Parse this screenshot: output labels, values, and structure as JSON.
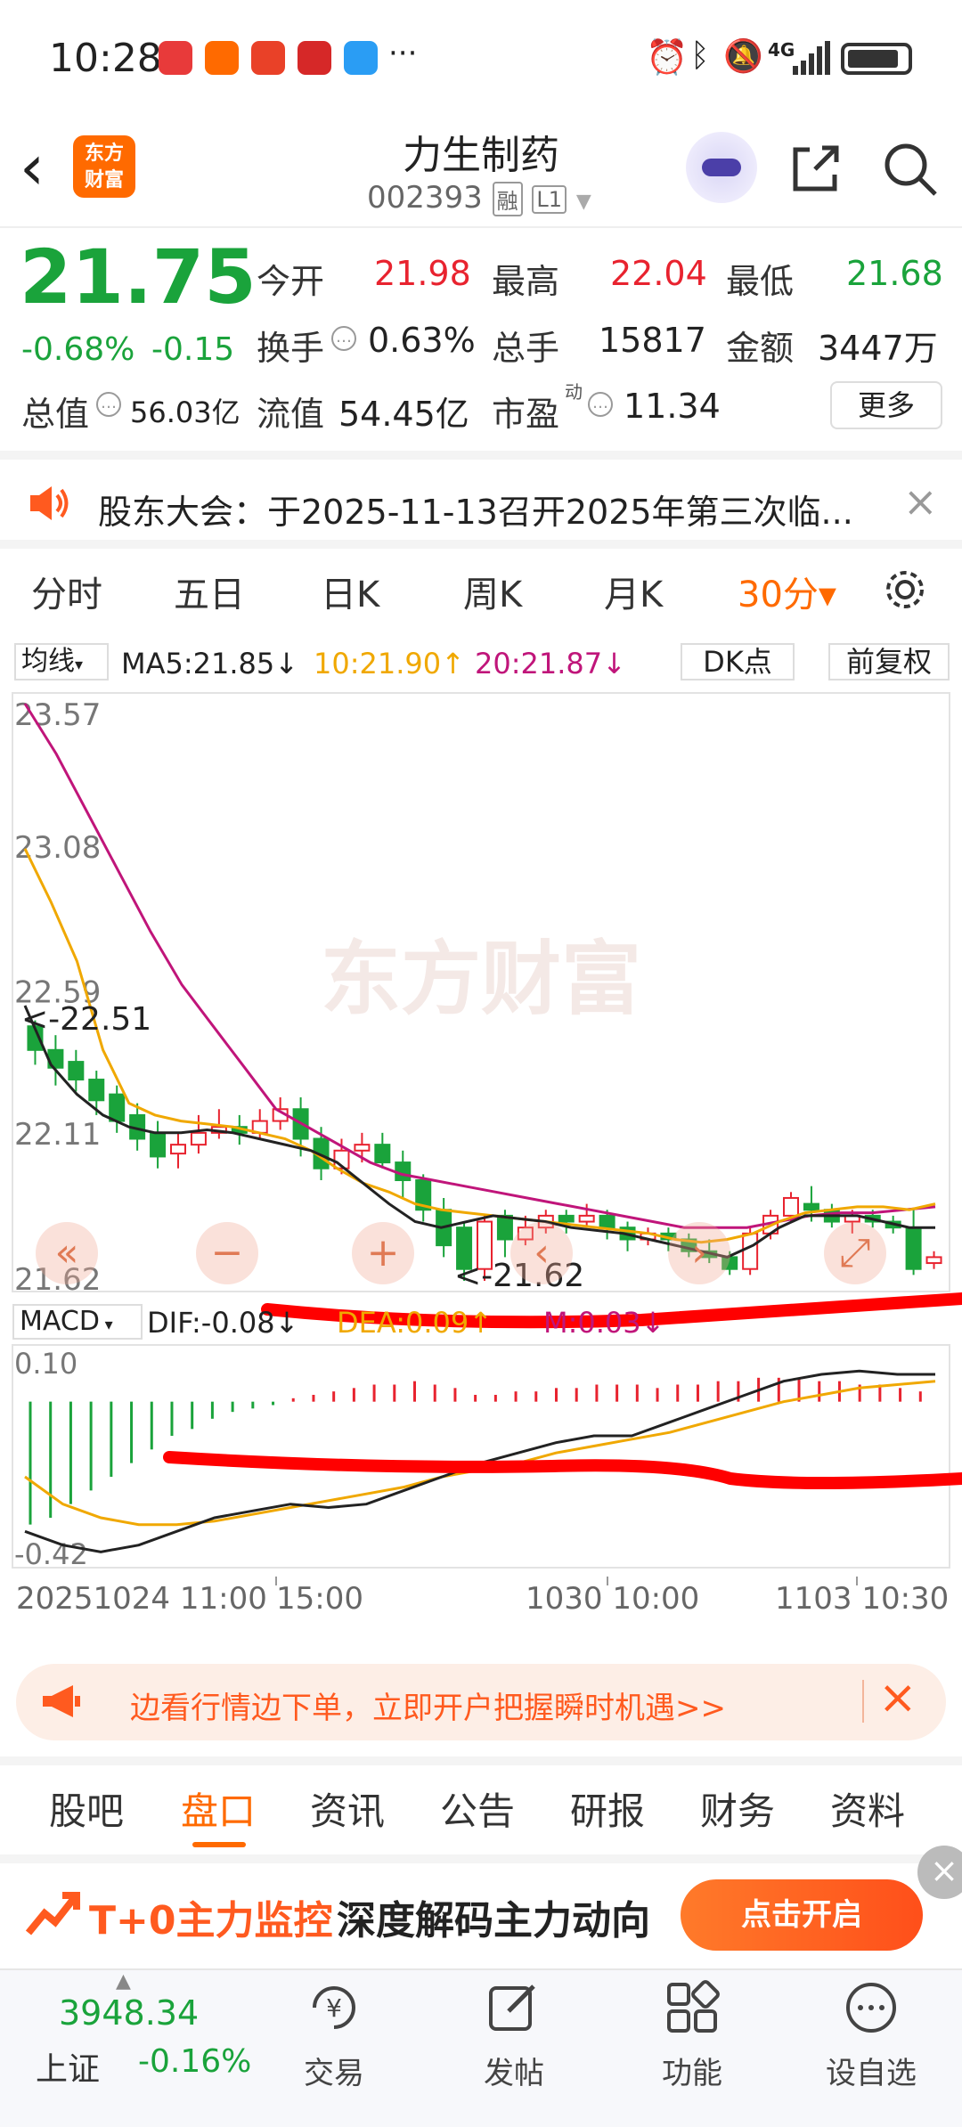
{
  "status_bar": {
    "time": "10:28",
    "dots": "···",
    "net": "4G"
  },
  "header": {
    "back_icon": "chevron-left",
    "logo_line1": "东方",
    "logo_line2": "财富",
    "title": "力生制药",
    "code": "002393",
    "tag_rong": "融",
    "tag_l1": "L1"
  },
  "quote": {
    "price": "21.75",
    "change_pct": "-0.68%",
    "change": "-0.15",
    "open_label": "今开",
    "open": "21.98",
    "high_label": "最高",
    "high": "22.04",
    "low_label": "最低",
    "low": "21.68",
    "turnover_label": "换手",
    "turnover": "0.63%",
    "volume_label": "总手",
    "volume": "15817",
    "amount_label": "金额",
    "amount": "3447万",
    "mktcap_label": "总值",
    "mktcap": "56.03亿",
    "float_label": "流值",
    "float": "54.45亿",
    "pe_label": "市盈",
    "pe_sup": "动",
    "pe": "11.34",
    "more": "更多"
  },
  "notice": {
    "text": "股东大会：于2025-11-13召开2025年第三次临..."
  },
  "ktabs": [
    "分时",
    "五日",
    "日K",
    "周K",
    "月K",
    "30分▾"
  ],
  "ma_bar": {
    "type": "均线",
    "ma5": "MA5:21.85↓",
    "ma10": "10:21.90↑",
    "ma20": "20:21.87↓",
    "dk": "DK点",
    "fq": "前复权"
  },
  "chart_data": {
    "type": "candlestick",
    "yticks": [
      "23.57",
      "23.08",
      "22.59",
      "22.11",
      "21.62"
    ],
    "high_marker": "<-22.51",
    "low_marker": "<-21.62",
    "xticks": [
      "20251024 11:00",
      "15:00",
      "1030 10:00",
      "1103 10:30"
    ],
    "watermark": "东方财富",
    "candles": [
      [
        22.48,
        22.4,
        22.5,
        22.35
      ],
      [
        22.4,
        22.34,
        22.45,
        22.28
      ],
      [
        22.36,
        22.3,
        22.4,
        22.26
      ],
      [
        22.3,
        22.23,
        22.33,
        22.18
      ],
      [
        22.25,
        22.16,
        22.28,
        22.12
      ],
      [
        22.18,
        22.1,
        22.22,
        22.06
      ],
      [
        22.12,
        22.04,
        22.16,
        22.0
      ],
      [
        22.05,
        22.08,
        22.12,
        22.0
      ],
      [
        22.08,
        22.12,
        22.18,
        22.05
      ],
      [
        22.12,
        22.14,
        22.2,
        22.1
      ],
      [
        22.14,
        22.12,
        22.18,
        22.08
      ],
      [
        22.12,
        22.16,
        22.2,
        22.1
      ],
      [
        22.16,
        22.2,
        22.24,
        22.13
      ],
      [
        22.2,
        22.1,
        22.24,
        22.04
      ],
      [
        22.1,
        22.0,
        22.14,
        21.96
      ],
      [
        22.0,
        22.06,
        22.1,
        21.98
      ],
      [
        22.06,
        22.08,
        22.12,
        22.02
      ],
      [
        22.08,
        22.02,
        22.12,
        22.0
      ],
      [
        22.02,
        21.96,
        22.06,
        21.9
      ],
      [
        21.96,
        21.86,
        21.98,
        21.82
      ],
      [
        21.86,
        21.74,
        21.9,
        21.7
      ],
      [
        21.8,
        21.66,
        21.82,
        21.62
      ],
      [
        21.66,
        21.82,
        21.84,
        21.62
      ],
      [
        21.84,
        21.76,
        21.86,
        21.7
      ],
      [
        21.76,
        21.8,
        21.84,
        21.74
      ],
      [
        21.8,
        21.84,
        21.86,
        21.78
      ],
      [
        21.84,
        21.82,
        21.86,
        21.78
      ],
      [
        21.82,
        21.84,
        21.88,
        21.8
      ],
      [
        21.84,
        21.8,
        21.86,
        21.76
      ],
      [
        21.8,
        21.76,
        21.82,
        21.72
      ],
      [
        21.76,
        21.78,
        21.8,
        21.74
      ],
      [
        21.78,
        21.76,
        21.8,
        21.72
      ],
      [
        21.76,
        21.72,
        21.78,
        21.7
      ],
      [
        21.72,
        21.7,
        21.76,
        21.68
      ],
      [
        21.7,
        21.66,
        21.72,
        21.64
      ],
      [
        21.66,
        21.78,
        21.8,
        21.64
      ],
      [
        21.78,
        21.84,
        21.86,
        21.76
      ],
      [
        21.84,
        21.9,
        21.92,
        21.82
      ],
      [
        21.88,
        21.86,
        21.94,
        21.82
      ],
      [
        21.86,
        21.82,
        21.88,
        21.8
      ],
      [
        21.82,
        21.84,
        21.86,
        21.78
      ],
      [
        21.84,
        21.82,
        21.86,
        21.8
      ],
      [
        21.82,
        21.8,
        21.84,
        21.78
      ],
      [
        21.8,
        21.66,
        21.86,
        21.64
      ],
      [
        21.68,
        21.7,
        21.72,
        21.66
      ]
    ],
    "ma5": [
      22.55,
      22.35,
      22.25,
      22.18,
      22.14,
      22.12,
      22.12,
      22.13,
      22.12,
      22.1,
      22.08,
      22.06,
      22.02,
      21.95,
      21.88,
      21.82,
      21.8,
      21.82,
      21.84,
      21.83,
      21.82,
      21.8,
      21.79,
      21.78,
      21.76,
      21.74,
      21.72,
      21.7,
      21.74,
      21.8,
      21.84,
      21.84,
      21.84,
      21.82,
      21.8,
      21.8
    ],
    "ma10": [
      23.08,
      22.9,
      22.7,
      22.4,
      22.22,
      22.18,
      22.16,
      22.15,
      22.14,
      22.12,
      22.1,
      22.06,
      22.0,
      21.95,
      21.92,
      21.88,
      21.86,
      21.85,
      21.84,
      21.83,
      21.82,
      21.81,
      21.8,
      21.79,
      21.78,
      21.76,
      21.75,
      21.76,
      21.78,
      21.82,
      21.85,
      21.86,
      21.87,
      21.87,
      21.86,
      21.88
    ],
    "ma20": [
      23.57,
      23.4,
      23.2,
      23.0,
      22.8,
      22.62,
      22.48,
      22.34,
      22.2,
      22.14,
      22.08,
      22.02,
      21.98,
      21.96,
      21.94,
      21.92,
      21.9,
      21.88,
      21.86,
      21.84,
      21.82,
      21.8,
      21.8,
      21.8,
      21.82,
      21.84,
      21.85,
      21.85,
      21.86,
      21.87
    ],
    "macd": {
      "label": "MACD",
      "dif": "DIF:-0.08↓",
      "dea": "DEA:0.09↑",
      "m": "M:0.03↓",
      "yticks": [
        "0.10",
        "-0.42"
      ]
    }
  },
  "ad": {
    "text": "边看行情边下单，立即开户把握瞬时机遇>>"
  },
  "btabs": [
    "股吧",
    "盘口",
    "资讯",
    "公告",
    "研报",
    "财务",
    "资料"
  ],
  "promo": {
    "title": "T+0主力监控",
    "subtitle": "深度解码主力动向",
    "button": "点击开启"
  },
  "index": {
    "value": "3948.34",
    "name": "上证",
    "change": "-0.16%"
  },
  "nav": [
    "交易",
    "发帖",
    "功能",
    "设自选"
  ],
  "colors": {
    "up": "#e8232f",
    "down": "#1aa33b",
    "accent": "#ff6a00",
    "ma5": "#222222",
    "ma10": "#f0a800",
    "ma20": "#c0157a"
  }
}
